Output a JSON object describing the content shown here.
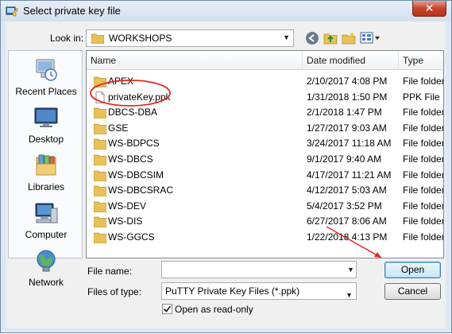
{
  "window": {
    "title": "Select private key file",
    "close_symbol": "✕"
  },
  "lookin": {
    "label": "Look in:",
    "value": "WORKSHOPS"
  },
  "toolbar": {
    "icons": [
      "back-icon",
      "up-folder-icon",
      "new-folder-icon",
      "view-menu-icon"
    ]
  },
  "places": [
    {
      "label": "Recent Places",
      "icon": "recent-places-icon"
    },
    {
      "label": "Desktop",
      "icon": "desktop-icon"
    },
    {
      "label": "Libraries",
      "icon": "libraries-icon"
    },
    {
      "label": "Computer",
      "icon": "computer-icon"
    },
    {
      "label": "Network",
      "icon": "network-icon"
    }
  ],
  "columns": {
    "name": "Name",
    "date": "Date modified",
    "type": "Type"
  },
  "files": [
    {
      "name": "APEX",
      "date": "2/10/2017 4:08 PM",
      "type": "File folder",
      "kind": "folder"
    },
    {
      "name": "privateKey.ppk",
      "date": "1/31/2018 1:50 PM",
      "type": "PPK File",
      "kind": "file"
    },
    {
      "name": "DBCS-DBA",
      "date": "2/1/2018 1:47 PM",
      "type": "File folder",
      "kind": "folder"
    },
    {
      "name": "GSE",
      "date": "1/27/2017 9:03 AM",
      "type": "File folder",
      "kind": "folder"
    },
    {
      "name": "WS-BDPCS",
      "date": "3/24/2017 11:18 AM",
      "type": "File folder",
      "kind": "folder"
    },
    {
      "name": "WS-DBCS",
      "date": "9/1/2017 9:40 AM",
      "type": "File folder",
      "kind": "folder"
    },
    {
      "name": "WS-DBCSIM",
      "date": "4/17/2017 11:21 AM",
      "type": "File folder",
      "kind": "folder"
    },
    {
      "name": "WS-DBCSRAC",
      "date": "4/12/2017 5:03 AM",
      "type": "File folder",
      "kind": "folder"
    },
    {
      "name": "WS-DEV",
      "date": "5/4/2017 3:52 PM",
      "type": "File folder",
      "kind": "folder"
    },
    {
      "name": "WS-DIS",
      "date": "6/27/2017 8:06 AM",
      "type": "File folder",
      "kind": "folder"
    },
    {
      "name": "WS-GGCS",
      "date": "1/22/2018 4:13 PM",
      "type": "File folder",
      "kind": "folder"
    }
  ],
  "filename": {
    "label": "File name:",
    "value": ""
  },
  "filetype": {
    "label": "Files of type:",
    "value": "PuTTY Private Key Files (*.ppk)"
  },
  "readonly": {
    "label": "Open as read-only",
    "checked": true
  },
  "buttons": {
    "open": "Open",
    "cancel": "Cancel"
  },
  "colors": {
    "annotation": "#e5261f",
    "folder": "#e9c15a",
    "accent": "#3c7fb1"
  }
}
